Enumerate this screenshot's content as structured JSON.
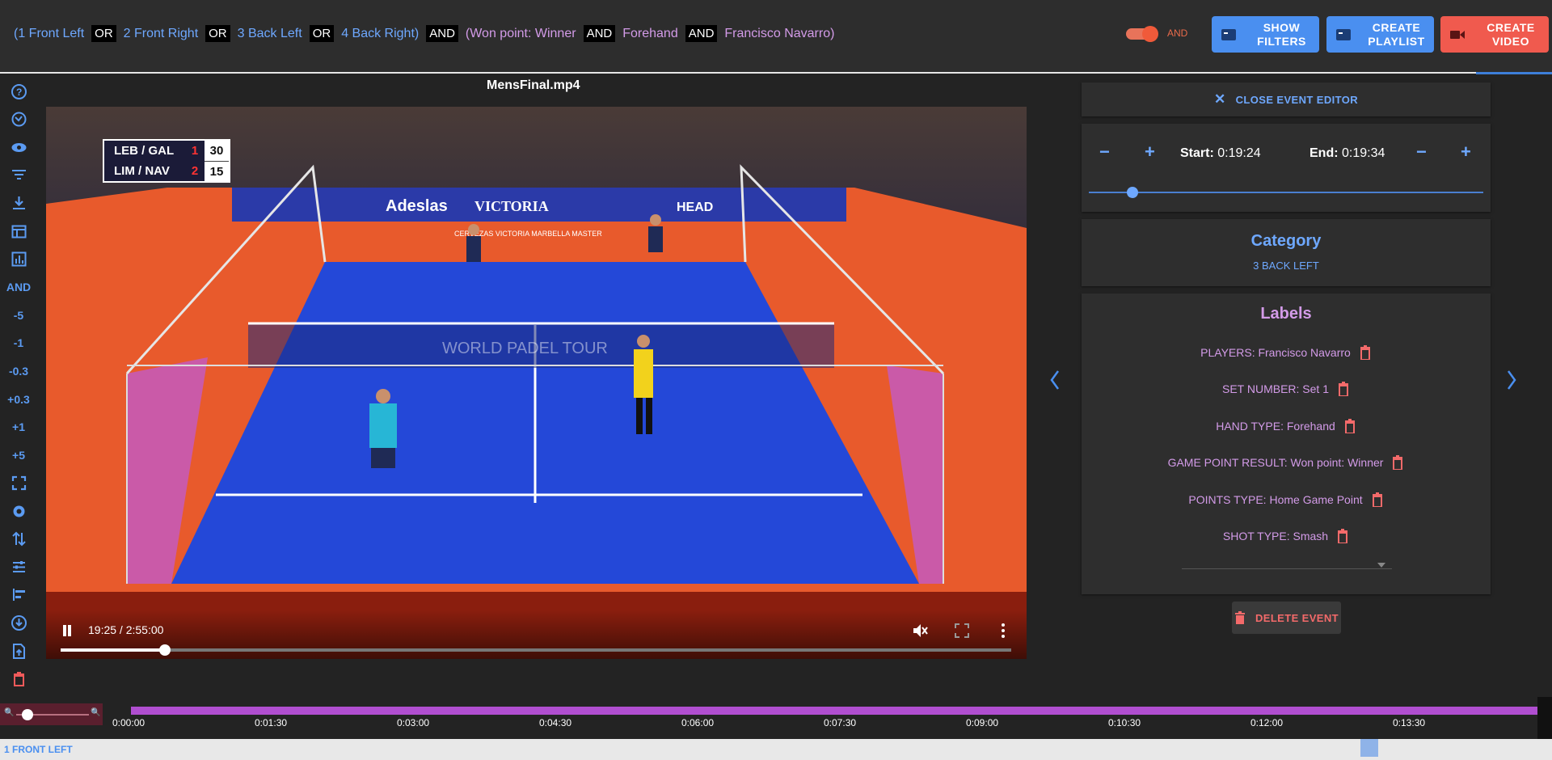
{
  "filter_expression": {
    "parts": [
      {
        "text": "(1 Front Left",
        "kind": "blue"
      },
      {
        "text": "OR",
        "kind": "op"
      },
      {
        "text": "2 Front Right",
        "kind": "blue"
      },
      {
        "text": "OR",
        "kind": "op"
      },
      {
        "text": "3 Back Left",
        "kind": "blue"
      },
      {
        "text": "OR",
        "kind": "op"
      },
      {
        "text": "4 Back Right)",
        "kind": "blue"
      },
      {
        "text": "AND",
        "kind": "op"
      },
      {
        "text": "(Won point: Winner",
        "kind": "purple"
      },
      {
        "text": "AND",
        "kind": "op"
      },
      {
        "text": "Forehand",
        "kind": "purple"
      },
      {
        "text": "AND",
        "kind": "op"
      },
      {
        "text": "Francisco Navarro)",
        "kind": "purple"
      }
    ]
  },
  "toggle": {
    "label": "AND",
    "on": true
  },
  "toolbar": {
    "show_filters": "SHOW FILTERS",
    "create_playlist": "CREATE PLAYLIST",
    "create_video": "CREATE VIDEO"
  },
  "left_toolbar": {
    "items": [
      {
        "name": "help-icon",
        "kind": "icon"
      },
      {
        "name": "sync-icon",
        "kind": "icon"
      },
      {
        "name": "eye-icon",
        "kind": "icon"
      },
      {
        "name": "filter-icon",
        "kind": "icon"
      },
      {
        "name": "download-icon",
        "kind": "icon"
      },
      {
        "name": "table-icon",
        "kind": "icon"
      },
      {
        "name": "chart-icon",
        "kind": "icon"
      },
      {
        "name": "and-toggle",
        "kind": "text",
        "label": "AND"
      },
      {
        "name": "skip-minus-5",
        "kind": "text",
        "label": "-5"
      },
      {
        "name": "skip-minus-1",
        "kind": "text",
        "label": "-1"
      },
      {
        "name": "skip-minus-0-3",
        "kind": "text",
        "label": "-0.3"
      },
      {
        "name": "skip-plus-0-3",
        "kind": "text",
        "label": "+0.3"
      },
      {
        "name": "skip-plus-1",
        "kind": "text",
        "label": "+1"
      },
      {
        "name": "skip-plus-5",
        "kind": "text",
        "label": "+5"
      },
      {
        "name": "fullscreen-icon",
        "kind": "icon"
      },
      {
        "name": "settings-icon",
        "kind": "icon"
      },
      {
        "name": "swap-icon",
        "kind": "icon"
      },
      {
        "name": "tune-icon",
        "kind": "icon"
      },
      {
        "name": "align-left-icon",
        "kind": "icon"
      },
      {
        "name": "download-circle-icon",
        "kind": "icon"
      },
      {
        "name": "upload-file-icon",
        "kind": "icon"
      },
      {
        "name": "trash-icon",
        "kind": "icon",
        "color": "#f05a5a"
      }
    ]
  },
  "video": {
    "title": "MensFinal.mp4",
    "time": "19:25 / 2:55:00",
    "progress_fraction": 0.11,
    "scoreboard": {
      "rows": [
        {
          "team": "LEB / GAL",
          "set": "1",
          "points": "30"
        },
        {
          "team": "LIM / NAV",
          "set": "2",
          "points": "15"
        }
      ]
    },
    "banners": {
      "adeslas": "Adeslas",
      "victoria": "VICTORIA",
      "head": "HEAD",
      "master": "CERVEZAS VICTORIA MARBELLA MASTER",
      "wpt": "WORLD PADEL TOUR"
    }
  },
  "editor": {
    "close_label": "CLOSE EVENT EDITOR",
    "start_label": "Start:",
    "start_value": "0:19:24",
    "end_label": "End:",
    "end_value": "0:19:34",
    "range_fraction": 0.11,
    "category_title": "Category",
    "category_value": "3 BACK LEFT",
    "labels_title": "Labels",
    "labels": [
      "PLAYERS: Francisco Navarro",
      "SET NUMBER: Set 1",
      "HAND TYPE: Forehand",
      "GAME POINT RESULT: Won point: Winner",
      "POINTS TYPE: Home Game Point",
      "SHOT TYPE: Smash"
    ],
    "delete_label": "DELETE EVENT"
  },
  "timeline": {
    "ticks": [
      "0:00:00",
      "0:01:30",
      "0:03:00",
      "0:04:30",
      "0:06:00",
      "0:07:30",
      "0:09:00",
      "0:10:30",
      "0:12:00",
      "0:13:30"
    ],
    "track_label": "1 FRONT LEFT",
    "zoom_fraction": 0.15
  },
  "colors": {
    "accent_blue": "#4a8ff0",
    "accent_red": "#f05a4e",
    "label_purple": "#d39be8",
    "timeline_purple": "#b04ed0"
  }
}
